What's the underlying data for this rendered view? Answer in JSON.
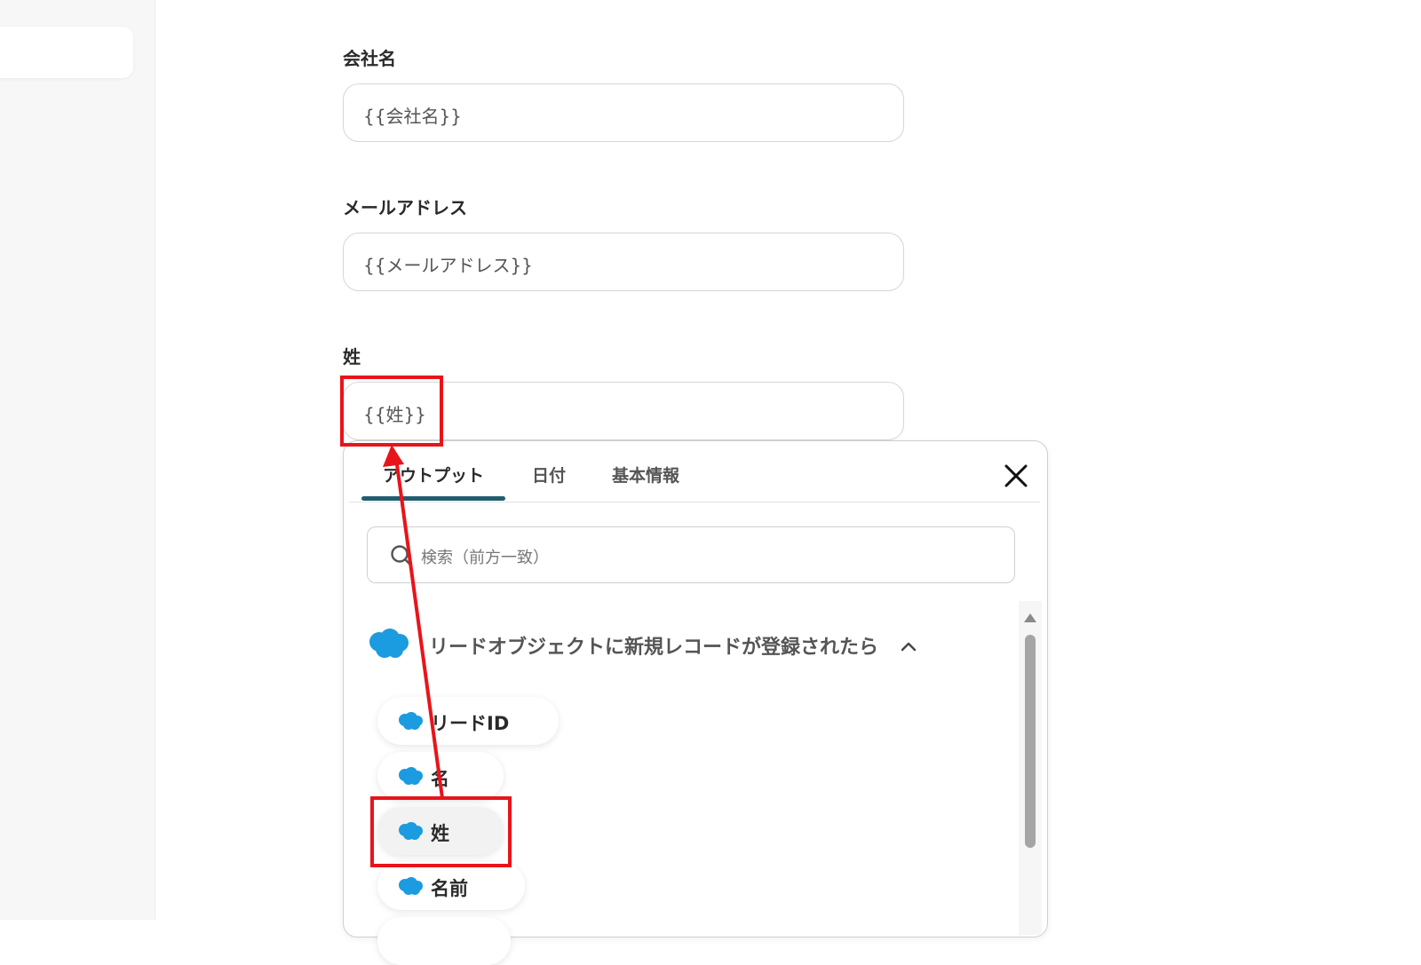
{
  "form": {
    "company": {
      "label": "会社名",
      "value": "{{会社名}}"
    },
    "email": {
      "label": "メールアドレス",
      "value": "{{メールアドレス}}"
    },
    "last_name": {
      "label": "姓",
      "value": "{{姓}}"
    }
  },
  "picker": {
    "tabs": [
      {
        "label": "アウトプット",
        "active": true
      },
      {
        "label": "日付",
        "active": false
      },
      {
        "label": "基本情報",
        "active": false
      }
    ],
    "search_placeholder": "検索（前方一致）",
    "group": {
      "title": "リードオブジェクトに新規レコードが登録されたら",
      "icon": "salesforce-cloud-icon",
      "items": [
        {
          "label": "リードID"
        },
        {
          "label": "名"
        },
        {
          "label": "姓"
        },
        {
          "label": "名前"
        }
      ]
    }
  },
  "colors": {
    "accent_tab": "#1f5e6e",
    "annotation_red": "#e8141a",
    "salesforce_blue": "#1b9be0"
  }
}
